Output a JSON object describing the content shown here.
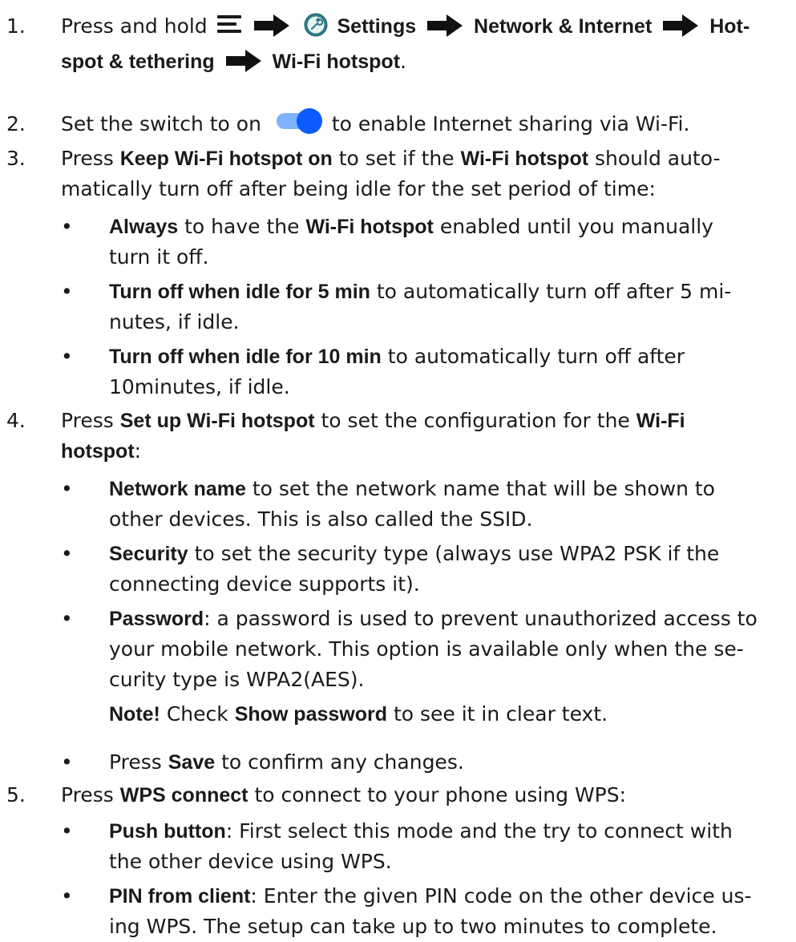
{
  "steps": [
    {
      "num": "1.",
      "parts": [
        "Press and hold",
        "Settings",
        "Network & Internet",
        "Hot-",
        "spot & tethering",
        "Wi-Fi hotspot",
        "."
      ]
    },
    {
      "num": "2.",
      "parts": [
        "Set the switch to on",
        "to enable Internet sharing via Wi-Fi."
      ]
    },
    {
      "num": "3.",
      "parts": [
        "Press ",
        "Keep Wi-Fi hotspot on",
        " to set if the ",
        "Wi-Fi hotspot",
        " should auto-",
        "matically turn off after being idle for the set period of time:"
      ],
      "subs": [
        {
          "bullet": "•",
          "parts": [
            "Always",
            " to have the ",
            "Wi-Fi hotspot",
            " enabled until you manually",
            "turn it off."
          ]
        },
        {
          "bullet": "•",
          "parts": [
            "Turn off when idle for 5 min",
            " to automatically turn off after 5 mi-",
            "nutes, if idle."
          ]
        },
        {
          "bullet": "•",
          "parts": [
            "Turn off when idle for 10 min",
            " to automatically turn off after",
            "10minutes, if idle."
          ]
        }
      ]
    },
    {
      "num": "4.",
      "parts": [
        "Press ",
        "Set up Wi-Fi hotspot",
        " to set the configuration for the ",
        "Wi-Fi",
        "hotspot",
        ":"
      ],
      "subs": [
        {
          "bullet": "•",
          "parts": [
            "Network name",
            " to set the network name that will be shown to",
            "other devices. This is also called the SSID."
          ]
        },
        {
          "bullet": "•",
          "parts": [
            "Security",
            " to set the security type (always use WPA2 PSK if the",
            "connecting device supports it)."
          ]
        },
        {
          "bullet": "•",
          "parts": [
            "Password",
            ": a password is used to prevent unauthorized access to",
            "your mobile network. This option is available only when the se-",
            "curity type is WPA2(AES)."
          ]
        }
      ],
      "note": [
        "Note!",
        " Check ",
        "Show password",
        " to see it in clear text."
      ],
      "extra": {
        "bullet": "•",
        "parts": [
          "Press ",
          "Save",
          " to confirm any changes."
        ]
      }
    },
    {
      "num": "5.",
      "parts": [
        "Press ",
        "WPS connect",
        " to connect to your phone using WPS:"
      ],
      "subs": [
        {
          "bullet": "•",
          "parts": [
            "Push button",
            ": First select this mode and the try to connect with",
            "the other device using WPS."
          ]
        },
        {
          "bullet": "•",
          "parts": [
            "PIN from client",
            ": Enter the given PIN code on the other device us-",
            "ing WPS. The setup can take up to two minutes to complete."
          ]
        }
      ]
    }
  ],
  "icons": {
    "menu": "hamburger-menu-icon",
    "arrow": "right-arrow-icon",
    "settings": "settings-wrench-icon",
    "toggle": "toggle-switch-on-icon"
  },
  "colors": {
    "text": "#1a1a1a",
    "toggle_track": "#7fb2ff",
    "toggle_knob": "#0a5cff",
    "settings_icon": "#2e7d8c"
  }
}
